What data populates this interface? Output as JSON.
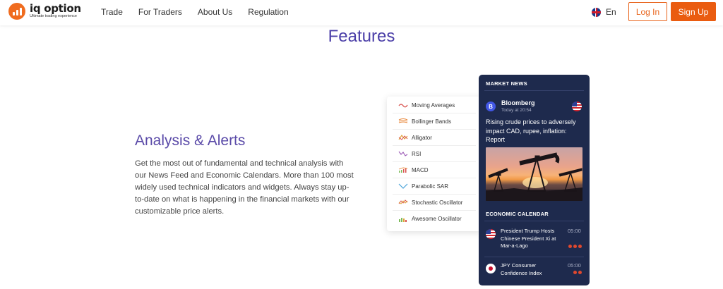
{
  "header": {
    "logo_name": "iq option",
    "logo_tagline": "Ultimate trading experience",
    "nav": [
      {
        "label": "Trade"
      },
      {
        "label": "For Traders"
      },
      {
        "label": "About Us"
      },
      {
        "label": "Regulation"
      }
    ],
    "language": "En",
    "login_label": "Log In",
    "signup_label": "Sign Up"
  },
  "colors": {
    "brand_orange": "#ea5c10",
    "title_purple": "#4b3fa8",
    "panel_navy": "#1e2a4d"
  },
  "page": {
    "title": "Features",
    "section_title": "Analysis & Alerts",
    "section_body": "Get the most out of fundamental and technical analysis with our News Feed and Economic Calendars. More than 100 most widely used technical indicators and widgets. Always stay up-to-date on what is happening in the financial markets with our customizable price alerts."
  },
  "indicators": [
    {
      "label": "Moving Averages",
      "icon": "moving-averages-icon"
    },
    {
      "label": "Bollinger Bands",
      "icon": "bollinger-bands-icon"
    },
    {
      "label": "Alligator",
      "icon": "alligator-icon"
    },
    {
      "label": "RSI",
      "icon": "rsi-icon"
    },
    {
      "label": "MACD",
      "icon": "macd-icon"
    },
    {
      "label": "Parabolic SAR",
      "icon": "parabolic-sar-icon"
    },
    {
      "label": "Stochastic Oscillator",
      "icon": "stochastic-oscillator-icon"
    },
    {
      "label": "Awesome Oscillator",
      "icon": "awesome-oscillator-icon"
    }
  ],
  "news": {
    "header": "MARKET NEWS",
    "source_initial": "B",
    "source_name": "Bloomberg",
    "time": "Today at 20:54",
    "headline": "Rising crude prices to adversely impact CAD, rupee, inflation: Report",
    "calendar_header": "ECONOMIC CALENDAR",
    "events": [
      {
        "title": "President Trump Hosts Chinese President Xi at Mar-a-Lago",
        "time": "05:00",
        "importance": 3,
        "flag": "us-flag-icon"
      },
      {
        "title": "JPY Consumer Confidence Index",
        "time": "05:00",
        "importance": 2,
        "flag": "japan-flag-icon"
      }
    ]
  }
}
